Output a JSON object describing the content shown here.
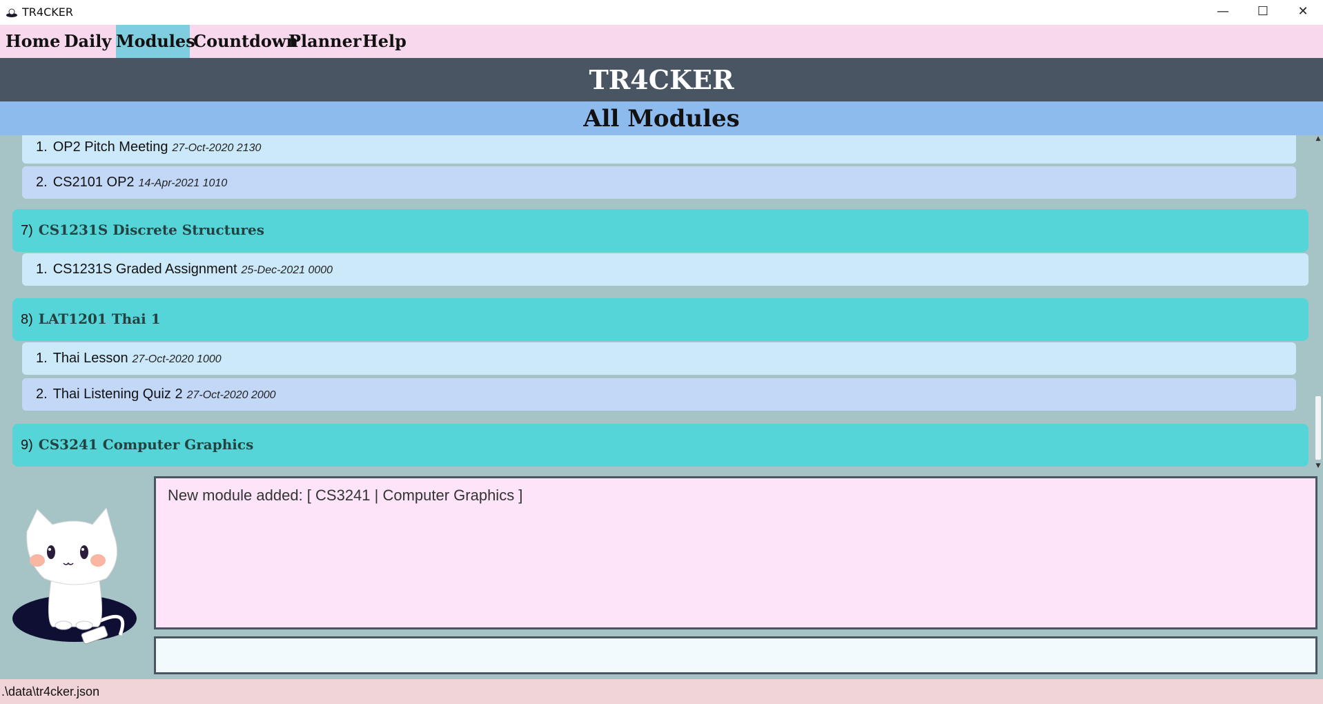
{
  "window": {
    "title": "TR4CKER",
    "minimize_glyph": "—",
    "maximize_glyph": "☐",
    "close_glyph": "✕"
  },
  "menu": {
    "items": [
      "Home",
      "Daily",
      "Modules",
      "Countdown",
      "Planner",
      "Help"
    ],
    "active": "Modules"
  },
  "header": {
    "title": "TR4CKER"
  },
  "subheader": {
    "title": "All Modules"
  },
  "list": {
    "prev_tasks": [
      {
        "index": "1.",
        "name": "OP2 Pitch Meeting",
        "date": "27-Oct-2020 2130"
      },
      {
        "index": "2.",
        "name": "CS2101 OP2",
        "date": "14-Apr-2021 1010"
      }
    ],
    "modules": [
      {
        "index": "7)",
        "name": "CS1231S Discrete Structures",
        "tasks": [
          {
            "index": "1.",
            "name": "CS1231S Graded Assignment",
            "date": "25-Dec-2021 0000"
          }
        ]
      },
      {
        "index": "8)",
        "name": "LAT1201 Thai 1",
        "tasks": [
          {
            "index": "1.",
            "name": "Thai Lesson",
            "date": "27-Oct-2020 1000"
          },
          {
            "index": "2.",
            "name": "Thai Listening Quiz 2",
            "date": "27-Oct-2020 2000"
          }
        ]
      },
      {
        "index": "9)",
        "name": "CS3241 Computer Graphics",
        "tasks": []
      }
    ]
  },
  "result": {
    "text": "New module added: [ CS3241 | Computer Graphics ]"
  },
  "command": {
    "value": "",
    "placeholder": ""
  },
  "status": {
    "path": ".\\data\\tr4cker.json"
  },
  "colors": {
    "menu_bg": "#f8d8ec",
    "menu_active": "#7fcee0",
    "header_bg": "#4a5563",
    "subheader_bg": "#8ebbee",
    "module_bg": "#56d5d8",
    "task_bg_a": "#cce9f9",
    "task_bg_b": "#c3d7f7",
    "result_bg": "#fde4f8"
  }
}
